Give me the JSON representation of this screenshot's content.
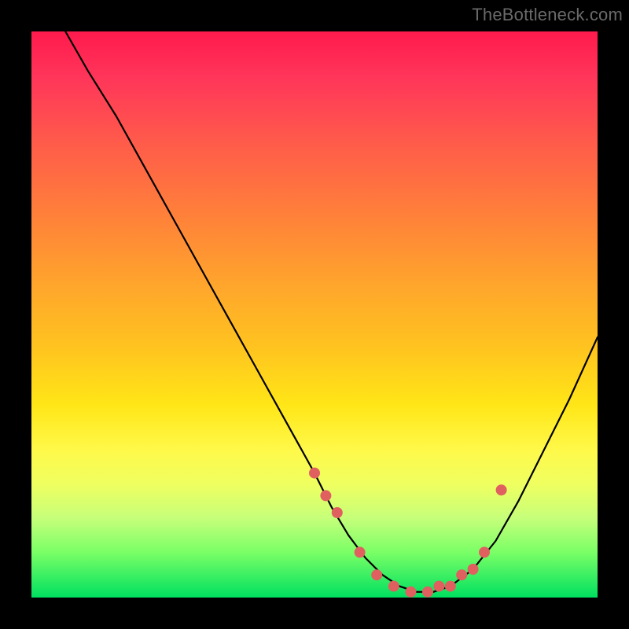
{
  "watermark": "TheBottleneck.com",
  "chart_data": {
    "type": "line",
    "title": "",
    "xlabel": "",
    "ylabel": "",
    "xlim": [
      0,
      100
    ],
    "ylim": [
      0,
      100
    ],
    "grid": false,
    "legend": false,
    "series": [
      {
        "name": "curve",
        "style": "line",
        "color": "#000000",
        "x": [
          6,
          10,
          15,
          20,
          25,
          30,
          35,
          40,
          45,
          50,
          53,
          56,
          59,
          62,
          65,
          68,
          71,
          74,
          78,
          82,
          86,
          90,
          95,
          100
        ],
        "y": [
          100,
          93,
          85,
          76,
          67,
          58,
          49,
          40,
          31,
          22,
          16,
          11,
          7,
          4,
          2,
          1,
          1,
          2,
          5,
          10,
          17,
          25,
          35,
          46
        ]
      },
      {
        "name": "highlight-points",
        "style": "scatter",
        "color": "#e06060",
        "x": [
          50,
          52,
          54,
          58,
          61,
          64,
          67,
          70,
          72,
          74,
          76,
          78,
          80,
          83
        ],
        "y": [
          22,
          18,
          15,
          8,
          4,
          2,
          1,
          1,
          2,
          2,
          4,
          5,
          8,
          19
        ]
      }
    ]
  }
}
